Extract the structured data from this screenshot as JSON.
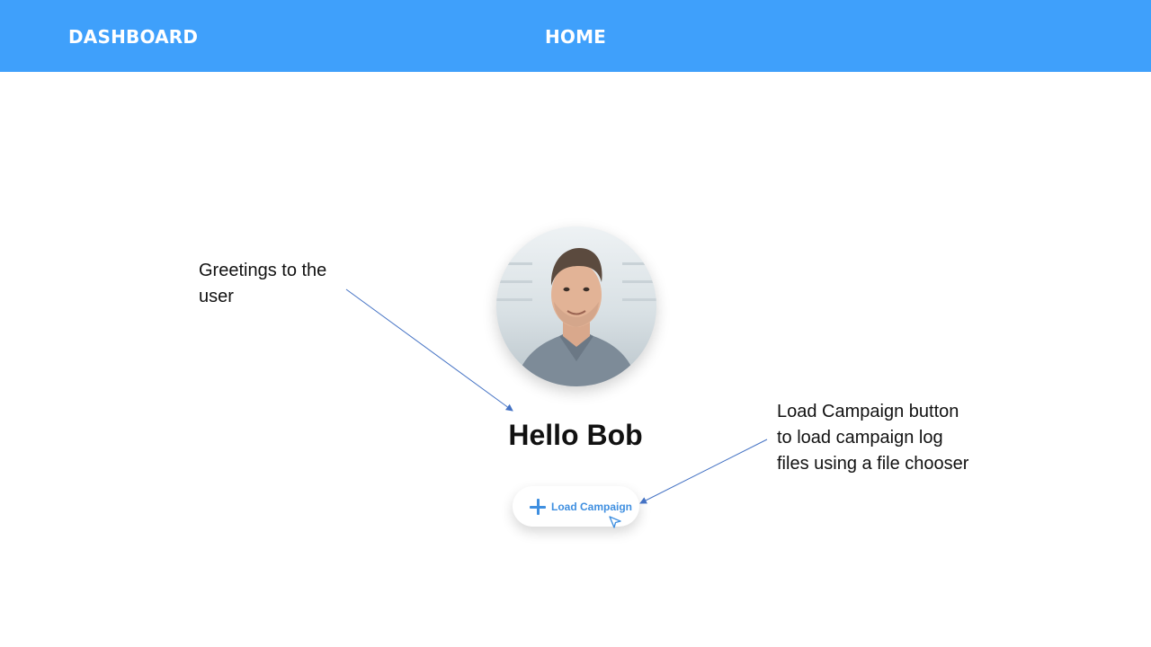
{
  "header": {
    "dashboard_label": "DASHBOARD",
    "home_label": "HOME",
    "background_color": "#3fa0fb"
  },
  "profile": {
    "greeting": "Hello Bob"
  },
  "actions": {
    "load_campaign_label": "Load Campaign",
    "accent_color": "#3f8fe0"
  },
  "annotations": {
    "greeting_note": {
      "lines": [
        "Greetings to the",
        "user"
      ]
    },
    "load_note": {
      "lines": [
        "Load Campaign button",
        "to load campaign log",
        "files using a file chooser"
      ]
    },
    "arrow_color": "#4472c4"
  },
  "icons": {
    "add": "plus-icon",
    "pointer": "cursor-icon"
  }
}
